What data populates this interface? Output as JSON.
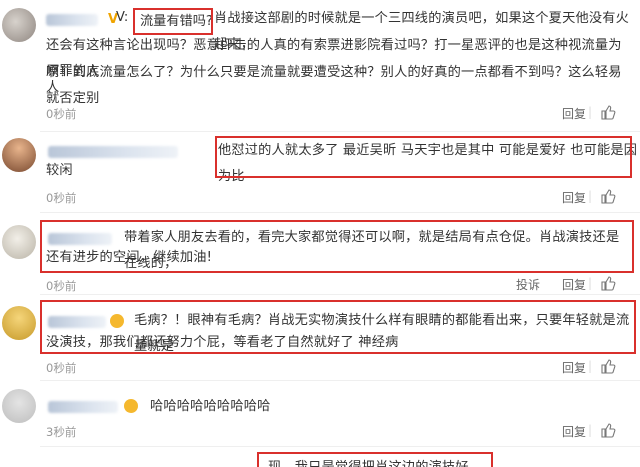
{
  "comments": [
    {
      "name_tail": "V:",
      "highlight": "流量有错吗?",
      "line1": "肖战接这部剧的时候就是一个三四线的演员吧，如果这个夏天他没有火起来，",
      "line2": "还会有这种言论出现吗？恶意抨击的人真的有索票进影院看过吗？打一星恶评的也是这种视流量为原罪的人",
      "line3": "啊！到底流量怎么了？为什么只要是流量就要遭受这种？别人的好真的一点都看不到吗？这么轻易就否定别",
      "line4": "人",
      "time": "0秒前",
      "reply": "回复"
    },
    {
      "line1": "他怼过的人就太多了 最近吴昕 马天宇也是其中 可能是爱好 也可能是因为比",
      "line2": "较闲",
      "time": "0秒前",
      "reply": "回复"
    },
    {
      "line1": "带着家人朋友去看的，看完大家都觉得还可以啊，就是结局有点仓促。肖战演技还是在线的，",
      "line2": "还有进步的空间，继续加油!",
      "time": "0秒前",
      "report": "投诉",
      "reply": "回复"
    },
    {
      "line1": "毛病？！眼神有毛病？肖战无实物演技什么样有眼睛的都能看出来，只要年轻就是流量就是",
      "line2": "没演技，那我们都还努力个屁，等看老了自然就好了 神经病",
      "time": "0秒前",
      "reply": "回复"
    },
    {
      "line1": "哈哈哈哈哈哈哈哈哈",
      "time": "3秒前",
      "reply": "回复"
    },
    {
      "line1": "现，我只是觉得把肖这边的演技好"
    }
  ],
  "colors": {
    "highlight": "#d9302c",
    "meta": "#999999",
    "text": "#333333"
  }
}
